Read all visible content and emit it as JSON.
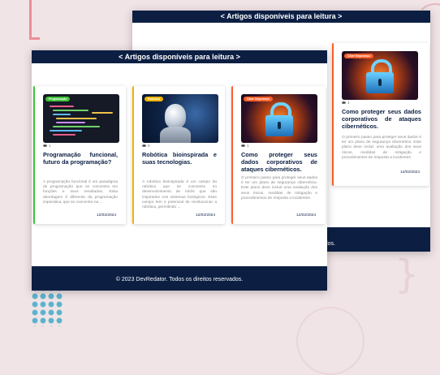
{
  "header_title": "< Artigos disponíveis para leitura >",
  "footer_text": "© 2023 DevRedator. Todos os direitos reservados.",
  "back_footer_visible": "dos.",
  "icons": [
    "eye-icon",
    "code-screen-icon",
    "robot-icon",
    "padlock-icon"
  ],
  "colors": {
    "header_bg": "#0c1f43",
    "badge_green": "#3ec437",
    "badge_yellow": "#f0b400",
    "badge_red": "#ff5f2a"
  },
  "front_cards": [
    {
      "badge": "Programação",
      "views": "1",
      "title": "Programação funcional, futuro da programação?",
      "excerpt": "A programação funcional é um paradigma de programação que se concentra em funções e seus resultados. Essa abordagem é diferente da programação imperativa, que se concentra na ...",
      "date": "12/02/2024"
    },
    {
      "badge": "Robótica",
      "views": "0",
      "title": "Robótica bioinspirada e suas tecnologias.",
      "excerpt": "A robótica bioinspirada é um campo da robótica que se concentra no desenvolvimento de robôs que são inspirados nos sistemas biológicos. Esse campo tem o potencial de revolucionar a robótica, permitindo ...",
      "date": "12/02/2024"
    },
    {
      "badge": "Ciber Segurança",
      "views": "1",
      "title": "Como proteger seus dados corporativos de ataques cibernéticos.",
      "excerpt": "O primeiro passo para proteger seus dados é ter um plano de segurança cibernética. Este plano deve incluir uma avaliação dos seus riscos, medidas de mitigação e procedimentos de resposta a incidentes.",
      "date": "12/02/2024"
    }
  ],
  "back_card": {
    "badge": "Ciber Segurança",
    "views": "1",
    "title": "Como proteger seus dados corporativos de ataques cibernéticos.",
    "excerpt": "O primeiro passo para proteger seus dados é ter um plano de segurança cibernética. Este plano deve incluir uma avaliação dos seus riscos, medidas de mitigação e procedimentos de resposta a incidentes.",
    "date": "12/02/2024"
  }
}
